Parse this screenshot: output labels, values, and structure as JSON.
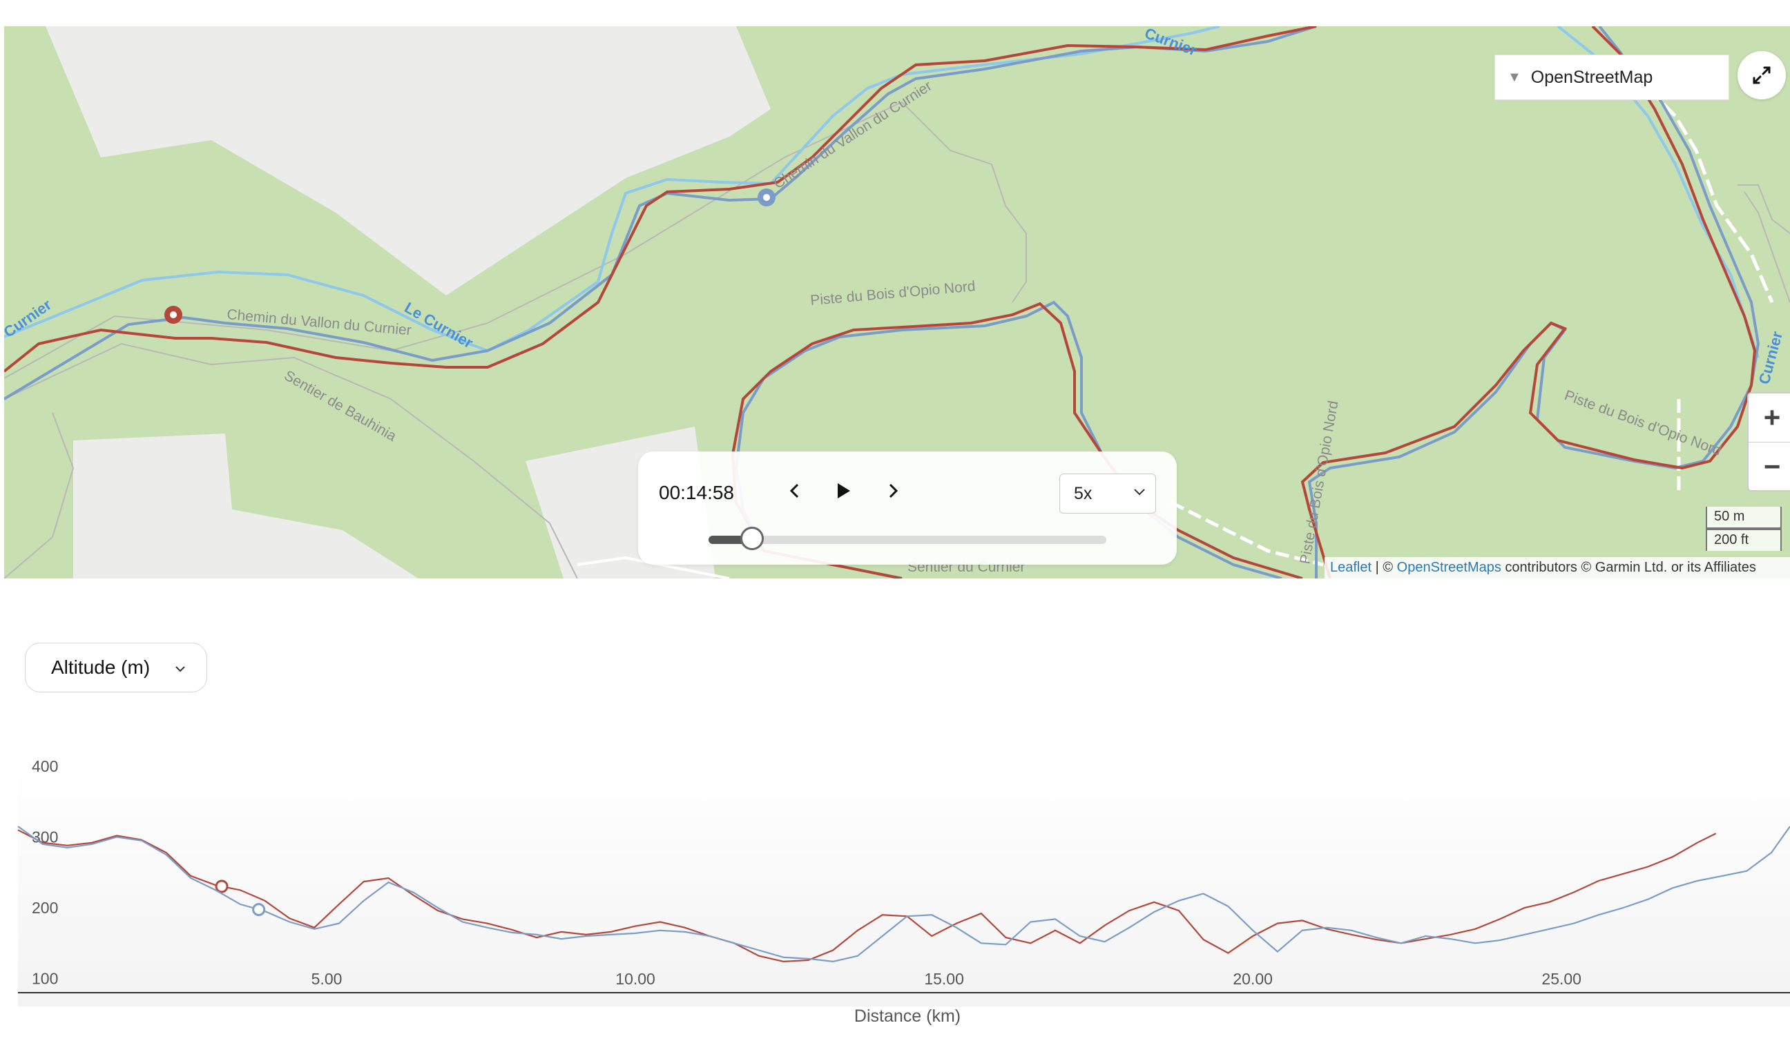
{
  "map": {
    "layer_label": "OpenStreetMap",
    "scale_metric": "50 m",
    "scale_imperial": "200 ft",
    "attribution": {
      "leaflet": "Leaflet",
      "separator": " | © ",
      "osm": "OpenStreetMaps",
      "rest": " contributors © Garmin Ltd. or its Affiliates"
    },
    "labels": {
      "chemin_vallon": "Chemin du Vallon du Curnier",
      "chemin_vallon_2": "Chemin du Vallon du Curnier",
      "le_curnier": "Le Curnier",
      "curnier_left": "Le Curnier",
      "curnier_top": "Curnier",
      "curnier_right": "Curnier",
      "sentier_bauhinia": "Sentier de Bauhinia",
      "piste_opio_nord": "Piste du Bois d'Opio Nord",
      "piste_opio_nord_2": "Piste du Bois d'Opio Nord",
      "bois_opio_vertical": "Piste du Bois d'Opio Nord",
      "sentier_curnier": "Sentier du Curnier"
    },
    "colors": {
      "track_red": "#b5473a",
      "track_blue": "#7a9cc9",
      "stream": "#8ec8ea",
      "forest": "#c8dfb2",
      "clearing": "#ececea"
    },
    "icons": {
      "zoom_in": "+",
      "zoom_out": "−",
      "fullscreen": "expand-arrows-icon",
      "layer_caret": "▼"
    }
  },
  "player": {
    "time": "00:14:58",
    "speed": "5x",
    "progress": 0.11
  },
  "chart": {
    "metric_label": "Altitude (m)",
    "xlabel": "Distance (km)"
  },
  "chart_data": {
    "type": "line",
    "xlabel": "Distance (km)",
    "ylabel": "",
    "xlim": [
      0,
      28.7
    ],
    "ylim": [
      80,
      400
    ],
    "xticks": [
      5,
      10,
      15,
      20,
      25
    ],
    "xtick_labels": [
      "5.00",
      "10.00",
      "15.00",
      "20.00",
      "25.00"
    ],
    "yticks": [
      100,
      200,
      300,
      400
    ],
    "ytick_labels": [
      "100",
      "200",
      "300",
      "400"
    ],
    "grid": false,
    "series": [
      {
        "color": "#b5473a",
        "marker_x": 3.3,
        "x": [
          0,
          0.4,
          0.8,
          1.2,
          1.6,
          2.0,
          2.4,
          2.8,
          3.2,
          3.6,
          4.0,
          4.4,
          4.8,
          5.2,
          5.6,
          6.0,
          6.4,
          6.8,
          7.2,
          7.6,
          8.0,
          8.4,
          8.8,
          9.2,
          9.6,
          10.0,
          10.4,
          10.8,
          11.2,
          11.6,
          12.0,
          12.4,
          12.8,
          13.2,
          13.6,
          14.0,
          14.4,
          14.8,
          15.2,
          15.6,
          16.0,
          16.4,
          16.8,
          17.2,
          17.6,
          18.0,
          18.4,
          18.8,
          19.2,
          19.6,
          20.0,
          20.4,
          20.8,
          21.2,
          21.6,
          22.0,
          22.4,
          22.8,
          23.2,
          23.6,
          24.0,
          24.4,
          24.8,
          25.2,
          25.6,
          26.0,
          26.4,
          26.8,
          27.2,
          27.5
        ],
        "y": [
          310,
          292,
          288,
          292,
          302,
          296,
          278,
          245,
          232,
          225,
          210,
          185,
          172,
          205,
          237,
          242,
          218,
          196,
          184,
          178,
          169,
          158,
          166,
          162,
          166,
          174,
          180,
          172,
          160,
          150,
          132,
          124,
          126,
          140,
          168,
          190,
          188,
          160,
          178,
          192,
          158,
          150,
          168,
          150,
          175,
          196,
          208,
          196,
          155,
          136,
          160,
          178,
          182,
          170,
          162,
          155,
          150,
          156,
          162,
          170,
          184,
          200,
          208,
          222,
          238,
          248,
          258,
          272,
          292,
          305
        ]
      },
      {
        "color": "#7a9cc9",
        "marker_x": 3.9,
        "x": [
          0,
          0.4,
          0.8,
          1.2,
          1.6,
          2.0,
          2.4,
          2.8,
          3.2,
          3.6,
          4.0,
          4.4,
          4.8,
          5.2,
          5.6,
          6.0,
          6.4,
          6.8,
          7.2,
          7.6,
          8.0,
          8.4,
          8.8,
          9.2,
          9.6,
          10.0,
          10.4,
          10.8,
          11.2,
          11.6,
          12.0,
          12.4,
          12.8,
          13.2,
          13.6,
          14.0,
          14.4,
          14.8,
          15.2,
          15.6,
          16.0,
          16.4,
          16.8,
          17.2,
          17.6,
          18.0,
          18.4,
          18.8,
          19.2,
          19.6,
          20.0,
          20.4,
          20.8,
          21.2,
          21.6,
          22.0,
          22.4,
          22.8,
          23.2,
          23.6,
          24.0,
          24.4,
          24.8,
          25.2,
          25.6,
          26.0,
          26.4,
          26.8,
          27.2,
          27.6,
          28.0,
          28.4,
          28.7
        ],
        "y": [
          315,
          290,
          285,
          290,
          300,
          295,
          275,
          242,
          225,
          205,
          195,
          180,
          170,
          178,
          210,
          236,
          222,
          200,
          180,
          172,
          165,
          162,
          156,
          160,
          162,
          164,
          168,
          166,
          160,
          150,
          140,
          130,
          128,
          124,
          132,
          160,
          188,
          190,
          172,
          150,
          148,
          180,
          184,
          160,
          152,
          172,
          194,
          210,
          220,
          202,
          168,
          138,
          168,
          172,
          168,
          158,
          150,
          160,
          156,
          150,
          154,
          162,
          170,
          178,
          190,
          200,
          212,
          228,
          238,
          245,
          252,
          278,
          315
        ]
      }
    ]
  }
}
